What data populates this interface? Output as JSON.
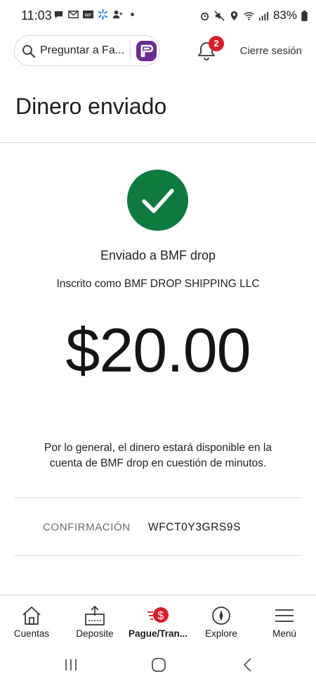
{
  "status_bar": {
    "time": "11:03",
    "battery": "83%"
  },
  "header": {
    "search_placeholder": "Preguntar a Fa...",
    "notification_count": "2",
    "signout_label": "Cierre sesión"
  },
  "page": {
    "title": "Dinero enviado"
  },
  "confirmation": {
    "sent_to": "Enviado a BMF drop",
    "enrolled_as": "Inscrito como BMF DROP SHIPPING LLC",
    "amount": "$20.00",
    "availability_note": "Por lo general, el dinero estará disponible en la cuenta de BMF drop en cuestión de minutos.",
    "confirmation_label": "CONFIRMACIÓN",
    "confirmation_code": "WFCT0Y3GRS9S"
  },
  "bottom_nav": {
    "items": [
      {
        "label": "Cuentas",
        "icon": "house-icon"
      },
      {
        "label": "Deposite",
        "icon": "deposit-icon"
      },
      {
        "label": "Pague/Tran...",
        "icon": "pay-transfer-icon",
        "active": true
      },
      {
        "label": "Explore",
        "icon": "compass-icon"
      },
      {
        "label": "Menú",
        "icon": "hamburger-menu-icon"
      }
    ]
  },
  "colors": {
    "brand_red": "#d71e28",
    "success_green": "#0f7a3e",
    "fargo_purple": "#6a2c91"
  }
}
